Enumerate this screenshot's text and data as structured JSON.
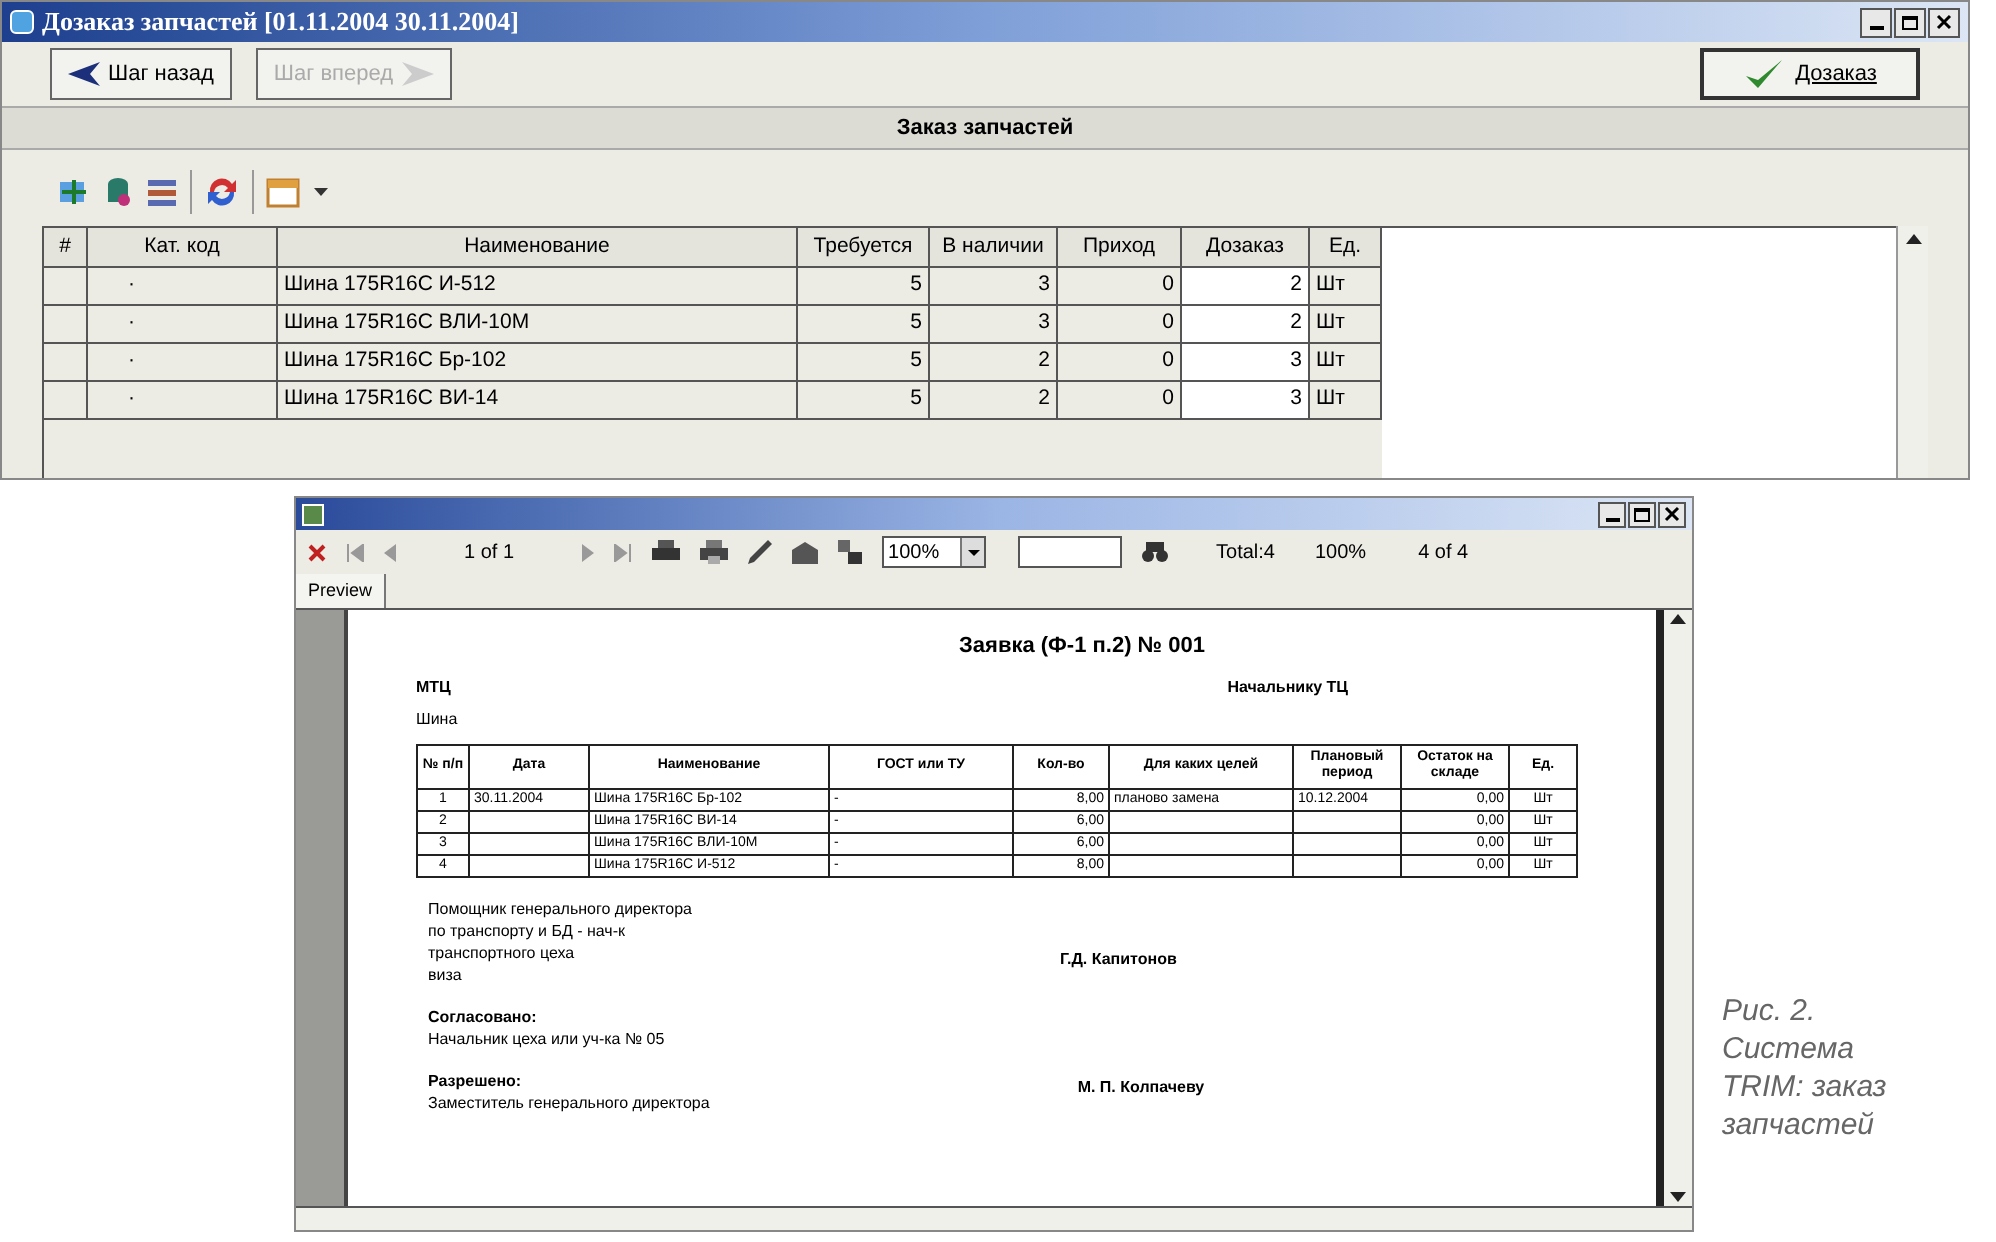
{
  "window": {
    "title": "Дозаказ запчастей [01.11.2004   30.11.2004]"
  },
  "nav_buttons": [
    {
      "label": "Шаг назад",
      "disabled": false,
      "kind": "back"
    },
    {
      "label": "Шаг вперед",
      "disabled": true,
      "kind": "forward"
    }
  ],
  "confirm_button": {
    "label": "Дозаказ"
  },
  "section_title": "Заказ запчастей",
  "table": {
    "columns": [
      "#",
      "Кат. код",
      "Наименование",
      "Требуется",
      "В наличии",
      "Приход",
      "Дозаказ",
      "Ед."
    ],
    "rows": [
      [
        "",
        "·",
        "Шина 175R16C И-512",
        "5",
        "3",
        "0",
        "2",
        "Шт"
      ],
      [
        "",
        "·",
        "Шина 175R16C ВЛИ-10М",
        "5",
        "3",
        "0",
        "2",
        "Шт"
      ],
      [
        "",
        "·",
        "Шина 175R16C Бр-102",
        "5",
        "2",
        "0",
        "3",
        "Шт"
      ],
      [
        "",
        "·",
        "Шина 175R16C ВИ-14",
        "5",
        "2",
        "0",
        "3",
        "Шт"
      ]
    ]
  },
  "preview": {
    "toolbar": {
      "page": "1 of 1",
      "zoom": "100%",
      "total": "Total:4",
      "percent": "100%",
      "count": "4 of 4"
    },
    "tab": "Preview",
    "document": {
      "title": "Заявка (Ф-1 п.2) № 001",
      "from": "МТЦ",
      "to": "Начальнику ТЦ",
      "subject": "Шина",
      "columns": [
        "№ п/п",
        "Дата",
        "Наименование",
        "ГОСТ или ТУ",
        "Кол-во",
        "Для каких целей",
        "Плановый период",
        "Остаток на складе",
        "Ед."
      ],
      "rows": [
        [
          "1",
          "30.11.2004",
          "Шина 175R16C Бр-102",
          "-",
          "8,00",
          "планово замена",
          "10.12.2004",
          "0,00",
          "Шт"
        ],
        [
          "2",
          "",
          "Шина 175R16C ВИ-14",
          "-",
          "6,00",
          "",
          "",
          "0,00",
          "Шт"
        ],
        [
          "3",
          "",
          "Шина 175R16C ВЛИ-10М",
          "-",
          "6,00",
          "",
          "",
          "0,00",
          "Шт"
        ],
        [
          "4",
          "",
          "Шина 175R16C И-512",
          "-",
          "8,00",
          "",
          "",
          "0,00",
          "Шт"
        ]
      ],
      "signatures": [
        {
          "lines": [
            "Помощник генерального директора",
            "по транспорту и БД - нач-к",
            "транспортного цеха",
            "виза"
          ],
          "name": "Г.Д. Капитонов"
        },
        {
          "heading": "Согласовано:",
          "lines": [
            "Начальник цеха или уч-ка № 05"
          ]
        },
        {
          "heading": "Разрешено:",
          "lines": [
            "Заместитель генерального директора"
          ],
          "name": "М. П. Колпачеву"
        }
      ]
    }
  },
  "caption": [
    "Рис. 2.",
    "Система",
    "TRIM: заказ",
    "запчастей"
  ]
}
